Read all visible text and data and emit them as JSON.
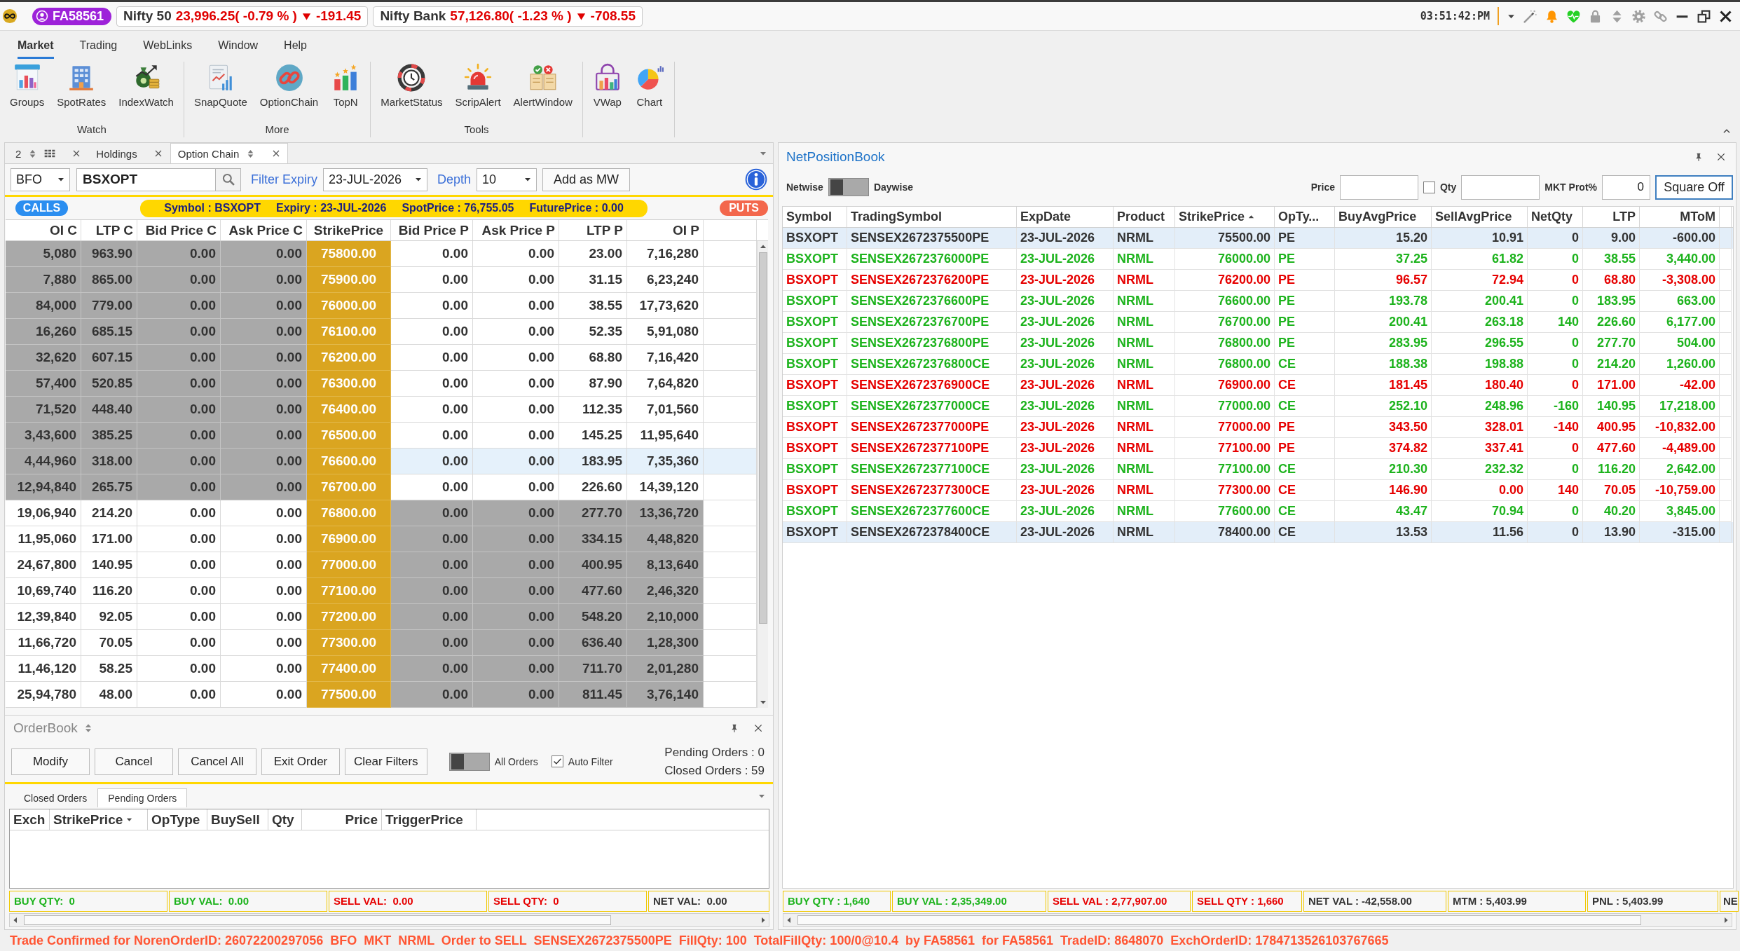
{
  "top_bar": {
    "user": "FA58561",
    "indices": [
      {
        "name": "Nifty 50",
        "value": "23,996.25( -0.79 % )",
        "change": "-191.45",
        "falling": true
      },
      {
        "name": "Nifty Bank",
        "value": "57,126.80( -1.23 % )",
        "change": "-708.55",
        "falling": true
      }
    ],
    "clock": "03:51:42:PM"
  },
  "menu": [
    {
      "label": "Market",
      "selected": true
    },
    {
      "label": "Trading",
      "selected": false
    },
    {
      "label": "WebLinks",
      "selected": false
    },
    {
      "label": "Window",
      "selected": false
    },
    {
      "label": "Help",
      "selected": false
    }
  ],
  "ribbon": {
    "groups": [
      {
        "label": "Watch",
        "items": [
          "Groups",
          "SpotRates",
          "IndexWatch"
        ]
      },
      {
        "label": "More",
        "items": [
          "SnapQuote",
          "OptionChain",
          "TopN"
        ]
      },
      {
        "label": "Tools",
        "items": [
          "MarketStatus",
          "ScripAlert",
          "AlertWindow"
        ]
      },
      {
        "items": [
          "VWap",
          "Chart"
        ]
      }
    ]
  },
  "option_chain": {
    "tabs": [
      {
        "kind": "counter",
        "label": "2",
        "selected": false
      },
      {
        "kind": "plain",
        "label": "Holdings",
        "selected": false
      },
      {
        "kind": "sortable",
        "label": "Option Chain",
        "selected": true
      }
    ],
    "exchange": "BFO",
    "symbol": "BSXOPT",
    "expiry_filter": {
      "label": "Filter Expiry",
      "value": "23-JUL-2026"
    },
    "depth": {
      "label": "Depth",
      "value": "10"
    },
    "add_button": "Add as MW",
    "calls_label": "CALLS",
    "banner": [
      "Symbol : BSXOPT",
      "Expiry : 23-JUL-2026",
      "SpotPrice : 76,755.05",
      "FuturePrice : 0.00"
    ],
    "puts_label": "PUTS",
    "columns": [
      "OI C",
      "LTP C",
      "Bid Price C",
      "Ask Price C",
      "StrikePrice",
      "Bid Price P",
      "Ask Price P",
      "LTP P",
      "OI P"
    ],
    "rows": [
      {
        "cells": [
          "5,080",
          "963.90",
          "0.00",
          "0.00",
          "75800.00",
          "0.00",
          "0.00",
          "23.00",
          "7,16,280"
        ],
        "calls_itm": true,
        "selected": false
      },
      {
        "cells": [
          "7,880",
          "865.00",
          "0.00",
          "0.00",
          "75900.00",
          "0.00",
          "0.00",
          "31.15",
          "6,23,240"
        ],
        "calls_itm": true,
        "selected": false
      },
      {
        "cells": [
          "84,000",
          "779.00",
          "0.00",
          "0.00",
          "76000.00",
          "0.00",
          "0.00",
          "38.55",
          "17,73,620"
        ],
        "calls_itm": true,
        "selected": false
      },
      {
        "cells": [
          "16,260",
          "685.15",
          "0.00",
          "0.00",
          "76100.00",
          "0.00",
          "0.00",
          "52.35",
          "5,91,080"
        ],
        "calls_itm": true,
        "selected": false
      },
      {
        "cells": [
          "32,620",
          "607.15",
          "0.00",
          "0.00",
          "76200.00",
          "0.00",
          "0.00",
          "68.80",
          "7,16,420"
        ],
        "calls_itm": true,
        "selected": false
      },
      {
        "cells": [
          "57,400",
          "520.85",
          "0.00",
          "0.00",
          "76300.00",
          "0.00",
          "0.00",
          "87.90",
          "7,64,820"
        ],
        "calls_itm": true,
        "selected": false
      },
      {
        "cells": [
          "71,520",
          "448.40",
          "0.00",
          "0.00",
          "76400.00",
          "0.00",
          "0.00",
          "112.35",
          "7,01,560"
        ],
        "calls_itm": true,
        "selected": false
      },
      {
        "cells": [
          "3,43,600",
          "385.25",
          "0.00",
          "0.00",
          "76500.00",
          "0.00",
          "0.00",
          "145.25",
          "11,95,640"
        ],
        "calls_itm": true,
        "selected": false
      },
      {
        "cells": [
          "4,44,960",
          "318.00",
          "0.00",
          "0.00",
          "76600.00",
          "0.00",
          "0.00",
          "183.95",
          "7,35,360"
        ],
        "calls_itm": true,
        "selected": true
      },
      {
        "cells": [
          "12,94,840",
          "265.75",
          "0.00",
          "0.00",
          "76700.00",
          "0.00",
          "0.00",
          "226.60",
          "14,39,120"
        ],
        "calls_itm": true,
        "selected": false
      },
      {
        "cells": [
          "19,06,940",
          "214.20",
          "0.00",
          "0.00",
          "76800.00",
          "0.00",
          "0.00",
          "277.70",
          "13,36,720"
        ],
        "calls_itm": false,
        "selected": false
      },
      {
        "cells": [
          "11,95,060",
          "171.00",
          "0.00",
          "0.00",
          "76900.00",
          "0.00",
          "0.00",
          "334.15",
          "4,48,820"
        ],
        "calls_itm": false,
        "selected": false
      },
      {
        "cells": [
          "24,67,800",
          "140.95",
          "0.00",
          "0.00",
          "77000.00",
          "0.00",
          "0.00",
          "400.95",
          "8,13,640"
        ],
        "calls_itm": false,
        "selected": false
      },
      {
        "cells": [
          "10,69,740",
          "116.20",
          "0.00",
          "0.00",
          "77100.00",
          "0.00",
          "0.00",
          "477.60",
          "2,46,320"
        ],
        "calls_itm": false,
        "selected": false
      },
      {
        "cells": [
          "12,39,840",
          "92.05",
          "0.00",
          "0.00",
          "77200.00",
          "0.00",
          "0.00",
          "548.20",
          "2,10,000"
        ],
        "calls_itm": false,
        "selected": false
      },
      {
        "cells": [
          "11,66,720",
          "70.05",
          "0.00",
          "0.00",
          "77300.00",
          "0.00",
          "0.00",
          "636.40",
          "1,28,300"
        ],
        "calls_itm": false,
        "selected": false
      },
      {
        "cells": [
          "11,46,120",
          "58.25",
          "0.00",
          "0.00",
          "77400.00",
          "0.00",
          "0.00",
          "711.70",
          "2,01,280"
        ],
        "calls_itm": false,
        "selected": false
      },
      {
        "cells": [
          "25,94,780",
          "48.00",
          "0.00",
          "0.00",
          "77500.00",
          "0.00",
          "0.00",
          "811.45",
          "3,76,140"
        ],
        "calls_itm": false,
        "selected": false
      }
    ]
  },
  "order_book": {
    "title": "OrderBook",
    "buttons": [
      "Modify",
      "Cancel",
      "Cancel All",
      "Exit Order",
      "Clear Filters"
    ],
    "all_orders": {
      "label": "All Orders",
      "on": false
    },
    "auto_filter": {
      "label": "Auto Filter",
      "checked": true
    },
    "counts": [
      "Pending Orders : 0",
      "Closed Orders : 59"
    ],
    "tabs": [
      {
        "label": "Closed Orders",
        "selected": false
      },
      {
        "label": "Pending Orders",
        "selected": true
      }
    ],
    "columns": [
      {
        "label": "Exch",
        "sorted": false
      },
      {
        "label": "StrikePrice",
        "sorted": true,
        "descending": true
      },
      {
        "label": "OpType",
        "sorted": false
      },
      {
        "label": "BuySell",
        "sorted": false
      },
      {
        "label": "Qty",
        "sorted": false
      },
      {
        "label": "Price",
        "sorted": false
      },
      {
        "label": "TriggerPrice",
        "sorted": false
      }
    ],
    "totals": [
      {
        "text": "BUY QTY:  0",
        "color": "#1db31d"
      },
      {
        "text": "BUY VAL:  0.00",
        "color": "#1db31d"
      },
      {
        "text": "SELL VAL:  0.00",
        "color": "#e60000"
      },
      {
        "text": "SELL QTY:  0",
        "color": "#e60000"
      },
      {
        "text": "NET VAL:  0.00",
        "color": "#333333"
      }
    ]
  },
  "net_positions": {
    "title": "NetPositionBook",
    "view_toggle": {
      "left_label": "Netwise",
      "right_label": "Daywise",
      "on": false
    },
    "price_field": {
      "label": "Price"
    },
    "qty": {
      "label": "Qty",
      "checked": false
    },
    "mkt_prot": {
      "label": "MKT Prot%",
      "value": "0"
    },
    "square_off_button": "Square Off",
    "columns": [
      {
        "label": "Symbol",
        "sorted": false
      },
      {
        "label": "TradingSymbol",
        "sorted": false
      },
      {
        "label": "ExpDate",
        "sorted": false
      },
      {
        "label": "Product",
        "sorted": false
      },
      {
        "label": "StrikePrice",
        "sorted": true,
        "descending": false
      },
      {
        "label": "OpTy...",
        "sorted": false
      },
      {
        "label": "BuyAvgPrice",
        "sorted": false
      },
      {
        "label": "SellAvgPrice",
        "sorted": false
      },
      {
        "label": "NetQty",
        "sorted": false
      },
      {
        "label": "LTP",
        "sorted": false
      },
      {
        "label": "MToM",
        "sorted": false
      }
    ],
    "rows": [
      {
        "cells": [
          "BSXOPT",
          "SENSEX2672375500PE",
          "23-JUL-2026",
          "NRML",
          "75500.00",
          "PE",
          "15.20",
          "10.91",
          "0",
          "9.00",
          "-600.00"
        ],
        "color": "#333333",
        "selected": true
      },
      {
        "cells": [
          "BSXOPT",
          "SENSEX2672376000PE",
          "23-JUL-2026",
          "NRML",
          "76000.00",
          "PE",
          "37.25",
          "61.82",
          "0",
          "38.55",
          "3,440.00"
        ],
        "color": "#1db31d",
        "selected": false
      },
      {
        "cells": [
          "BSXOPT",
          "SENSEX2672376200PE",
          "23-JUL-2026",
          "NRML",
          "76200.00",
          "PE",
          "96.57",
          "72.94",
          "0",
          "68.80",
          "-3,308.00"
        ],
        "color": "#e60000",
        "selected": false
      },
      {
        "cells": [
          "BSXOPT",
          "SENSEX2672376600PE",
          "23-JUL-2026",
          "NRML",
          "76600.00",
          "PE",
          "193.78",
          "200.41",
          "0",
          "183.95",
          "663.00"
        ],
        "color": "#1db31d",
        "selected": false
      },
      {
        "cells": [
          "BSXOPT",
          "SENSEX2672376700PE",
          "23-JUL-2026",
          "NRML",
          "76700.00",
          "PE",
          "200.41",
          "263.18",
          "140",
          "226.60",
          "6,177.00"
        ],
        "color": "#1db31d",
        "selected": false
      },
      {
        "cells": [
          "BSXOPT",
          "SENSEX2672376800PE",
          "23-JUL-2026",
          "NRML",
          "76800.00",
          "PE",
          "283.95",
          "296.55",
          "0",
          "277.70",
          "504.00"
        ],
        "color": "#1db31d",
        "selected": false
      },
      {
        "cells": [
          "BSXOPT",
          "SENSEX2672376800CE",
          "23-JUL-2026",
          "NRML",
          "76800.00",
          "CE",
          "188.38",
          "198.88",
          "0",
          "214.20",
          "1,260.00"
        ],
        "color": "#1db31d",
        "selected": false
      },
      {
        "cells": [
          "BSXOPT",
          "SENSEX2672376900CE",
          "23-JUL-2026",
          "NRML",
          "76900.00",
          "CE",
          "181.45",
          "180.40",
          "0",
          "171.00",
          "-42.00"
        ],
        "color": "#e60000",
        "selected": false
      },
      {
        "cells": [
          "BSXOPT",
          "SENSEX2672377000CE",
          "23-JUL-2026",
          "NRML",
          "77000.00",
          "CE",
          "252.10",
          "248.96",
          "-160",
          "140.95",
          "17,218.00"
        ],
        "color": "#1db31d",
        "selected": false
      },
      {
        "cells": [
          "BSXOPT",
          "SENSEX2672377000PE",
          "23-JUL-2026",
          "NRML",
          "77000.00",
          "PE",
          "343.50",
          "328.01",
          "-140",
          "400.95",
          "-10,832.00"
        ],
        "color": "#e60000",
        "selected": false
      },
      {
        "cells": [
          "BSXOPT",
          "SENSEX2672377100PE",
          "23-JUL-2026",
          "NRML",
          "77100.00",
          "PE",
          "374.82",
          "337.41",
          "0",
          "477.60",
          "-4,489.00"
        ],
        "color": "#e60000",
        "selected": false
      },
      {
        "cells": [
          "BSXOPT",
          "SENSEX2672377100CE",
          "23-JUL-2026",
          "NRML",
          "77100.00",
          "CE",
          "210.30",
          "232.32",
          "0",
          "116.20",
          "2,642.00"
        ],
        "color": "#1db31d",
        "selected": false
      },
      {
        "cells": [
          "BSXOPT",
          "SENSEX2672377300CE",
          "23-JUL-2026",
          "NRML",
          "77300.00",
          "CE",
          "146.90",
          "0.00",
          "140",
          "70.05",
          "-10,759.00"
        ],
        "color": "#e60000",
        "selected": false
      },
      {
        "cells": [
          "BSXOPT",
          "SENSEX2672377600CE",
          "23-JUL-2026",
          "NRML",
          "77600.00",
          "CE",
          "43.47",
          "70.94",
          "0",
          "40.20",
          "3,845.00"
        ],
        "color": "#1db31d",
        "selected": false
      },
      {
        "cells": [
          "BSXOPT",
          "SENSEX2672378400CE",
          "23-JUL-2026",
          "NRML",
          "78400.00",
          "CE",
          "13.53",
          "11.56",
          "0",
          "13.90",
          "-315.00"
        ],
        "color": "#333333",
        "selected": true
      }
    ],
    "totals": [
      {
        "text": "BUY QTY : 1,640",
        "color": "#1db31d"
      },
      {
        "text": "BUY VAL : 2,35,349.00",
        "color": "#1db31d"
      },
      {
        "text": "SELL VAL : 2,77,907.00",
        "color": "#e60000"
      },
      {
        "text": "SELL QTY : 1,660",
        "color": "#e60000"
      },
      {
        "text": "NET VAL : -42,558.00",
        "color": "#333333"
      },
      {
        "text": "MTM : 5,403.99",
        "color": "#333333"
      },
      {
        "text": "PNL : 5,403.99",
        "color": "#333333"
      },
      {
        "text": "NE",
        "color": "#333333"
      }
    ]
  },
  "status_message": "Trade Confirmed for NorenOrderID: 26072200297056  BFO  MKT  NRML  Order to SELL  SENSEX2672375500PE  FillQty: 100  TotalFillQty: 100/0@10.4  by FA58561  for FA58561  TradeID: 8648070  ExchOrderID: 1784713526103767665"
}
